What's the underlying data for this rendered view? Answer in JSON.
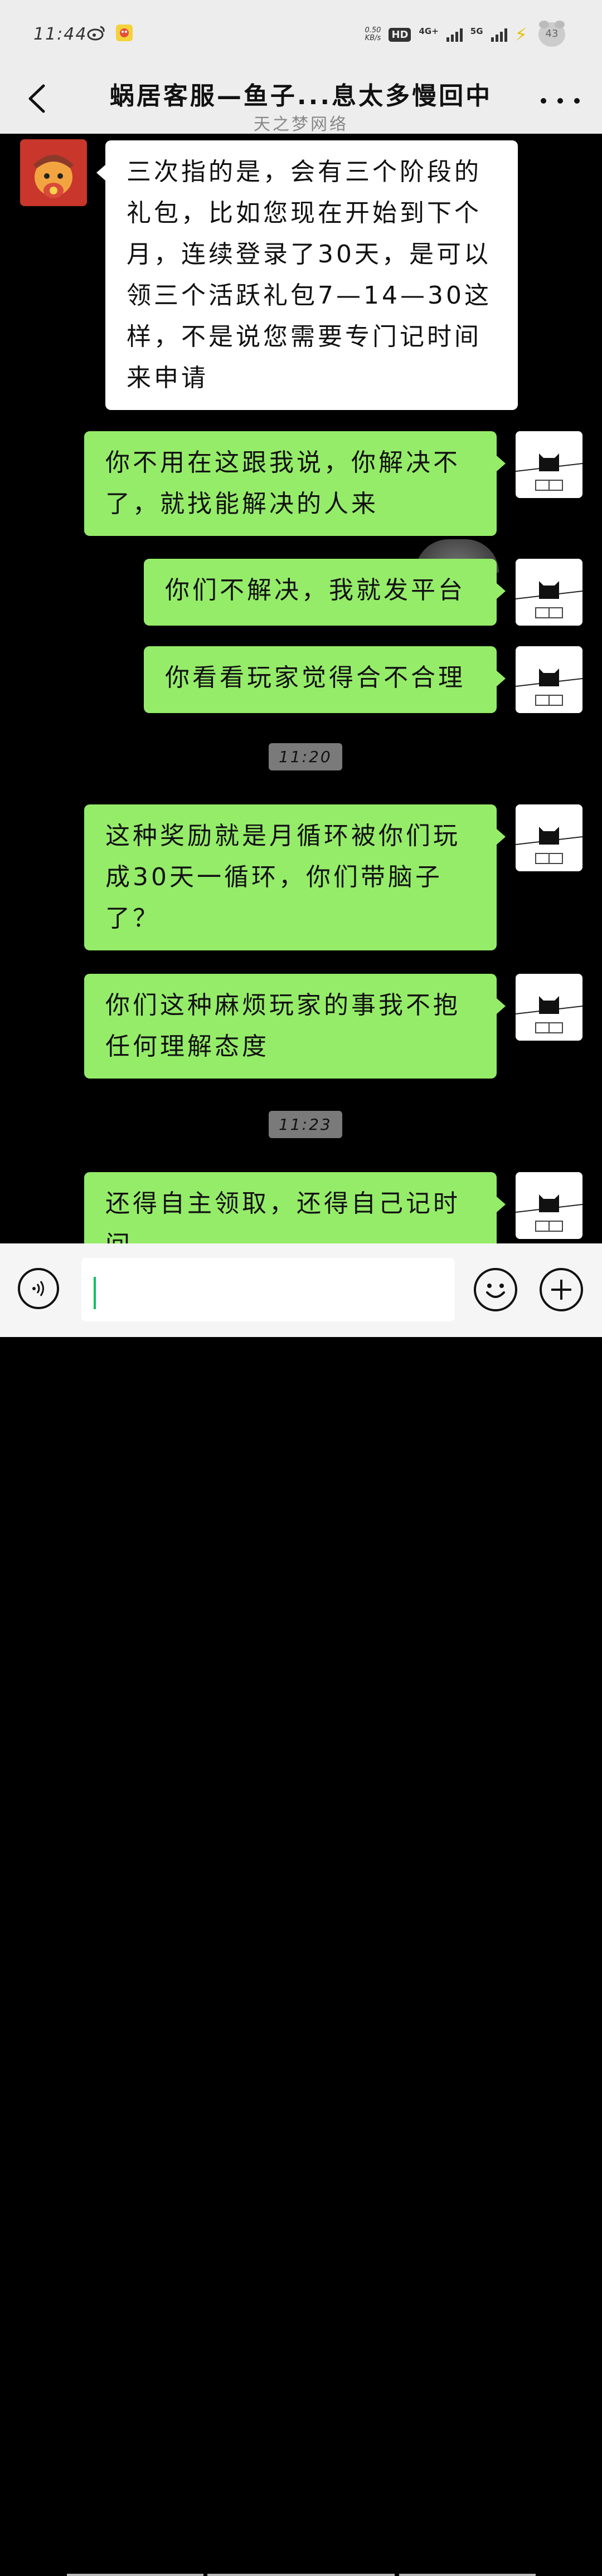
{
  "status_bar": {
    "time": "11:44",
    "net_speed": "0.50",
    "net_speed_unit": "KB/s",
    "hd_label": "HD",
    "sim1_label": "4G+",
    "sim2_label": "5G",
    "battery": "43"
  },
  "header": {
    "title": "蜗居客服—鱼子...息太多慢回中",
    "subtitle": "天之梦网络"
  },
  "messages": [
    {
      "side": "in",
      "text": "三次指的是，会有三个阶段的礼包，比如您现在开始到下个月，连续登录了30天，是可以领三个活跃礼包7—14—30这样，不是说您需要专门记时间来申请"
    },
    {
      "side": "out",
      "text": "你不用在这跟我说，你解决不了，就找能解决的人来"
    },
    {
      "side": "out",
      "text": "你们不解决，我就发平台"
    },
    {
      "side": "out",
      "text": "你看看玩家觉得合不合理"
    },
    {
      "type": "time",
      "text": "11:20"
    },
    {
      "side": "out",
      "text": "这种奖励就是月循环被你们玩成30天一循环，你们带脑子了？"
    },
    {
      "side": "out",
      "text": "你们这种麻烦玩家的事我不抱任何理解态度"
    },
    {
      "type": "time",
      "text": "11:23"
    },
    {
      "side": "out",
      "text": "还得自主领取，还得自己记时间"
    }
  ],
  "input": {
    "value": ""
  },
  "icons": {
    "back": "back-arrow-icon",
    "more": "more-dots-icon",
    "voice": "voice-icon",
    "emoji": "emoji-icon",
    "plus": "plus-icon"
  },
  "colors": {
    "outgoing_bubble": "#95ec69",
    "incoming_bubble": "#ffffff",
    "chat_background": "#000000",
    "header_background": "#ededed",
    "caret": "#07c160"
  }
}
